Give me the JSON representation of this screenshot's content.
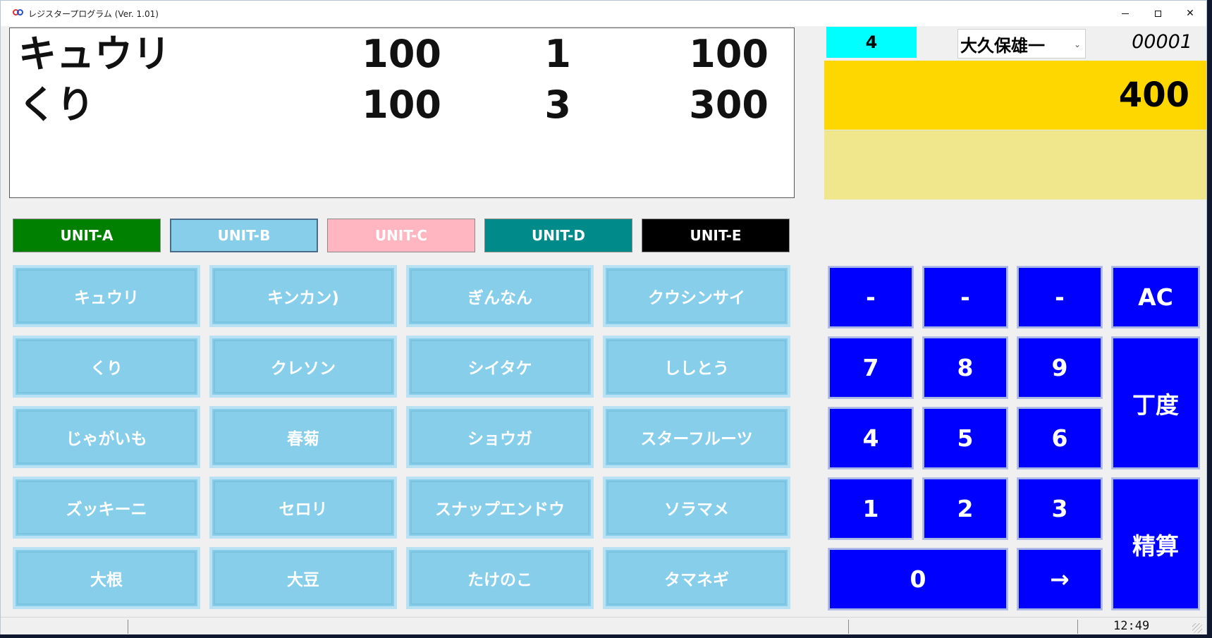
{
  "window": {
    "title": "レジスタープログラム (Ver. 1.01)",
    "controls": {
      "minimize": "",
      "maximize": "",
      "close": "✕"
    }
  },
  "receipt": {
    "lines": [
      {
        "name": "キュウリ",
        "price": "100",
        "qty": "1",
        "total": "100"
      },
      {
        "name": "くり",
        "price": "100",
        "qty": "3",
        "total": "300"
      }
    ]
  },
  "units": [
    {
      "label": "UNIT-A",
      "color": "#008000"
    },
    {
      "label": "UNIT-B",
      "color": "#87ceeb"
    },
    {
      "label": "UNIT-C",
      "color": "#ffb6c1"
    },
    {
      "label": "UNIT-D",
      "color": "#008b8b"
    },
    {
      "label": "UNIT-E",
      "color": "#000000"
    }
  ],
  "products": [
    "キュウリ",
    "キンカン)",
    "ぎんなん",
    "クウシンサイ",
    "くり",
    "クレソン",
    "シイタケ",
    "ししとう",
    "じゃがいも",
    "春菊",
    "ショウガ",
    "スターフルーツ",
    "ズッキーニ",
    "セロリ",
    "スナップエンドウ",
    "ソラマメ",
    "大根",
    "大豆",
    "たけのこ",
    "タマネギ"
  ],
  "info": {
    "counter": "4",
    "staff": "大久保雄一",
    "receipt_no": "00001",
    "total": "400",
    "message": ""
  },
  "keypad": {
    "minus1": "-",
    "minus2": "-",
    "minus3": "-",
    "ac": "AC",
    "k7": "7",
    "k8": "8",
    "k9": "9",
    "exact": "丁度",
    "k4": "4",
    "k5": "5",
    "k6": "6",
    "k1": "1",
    "k2": "2",
    "k3": "3",
    "checkout": "精算",
    "k0": "0",
    "arrow": "→"
  },
  "status": {
    "time": "12:49"
  }
}
